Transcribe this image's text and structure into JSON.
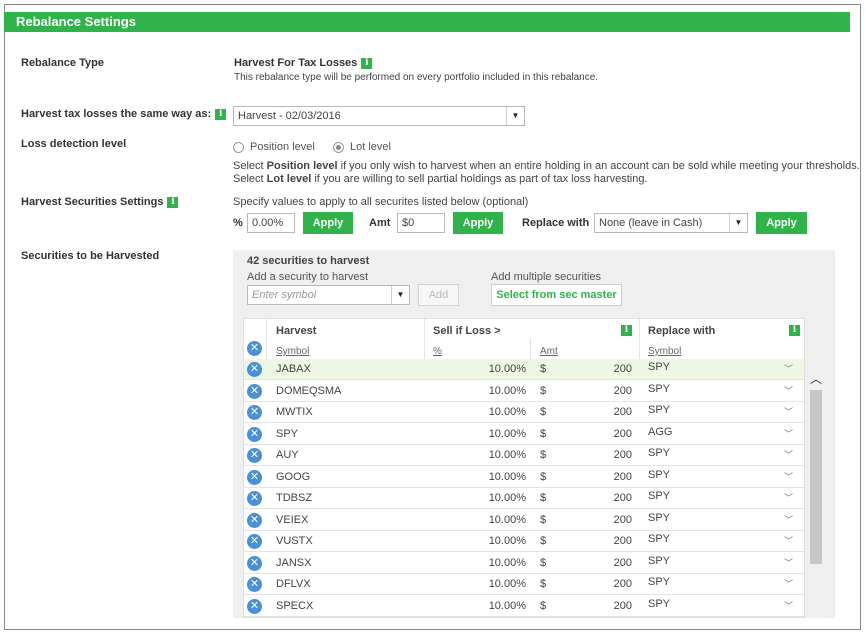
{
  "header": {
    "title": "Rebalance Settings"
  },
  "rebalance_type": {
    "label": "Rebalance Type",
    "value": "Harvest For Tax Losses",
    "description": "This rebalance type will be performed on every portfolio included in this rebalance."
  },
  "harvest_same": {
    "label": "Harvest tax losses the same way as:",
    "selected": "Harvest - 02/03/2016"
  },
  "loss_detection": {
    "label": "Loss detection level",
    "option_position": "Position level",
    "option_lot": "Lot level",
    "selected": "Lot level",
    "help1_pre": "Select ",
    "help1_bold": "Position level",
    "help1_post": " if you only wish to harvest when an entire holding in an account can be sold while meeting your thresholds.",
    "help2_pre": "Select ",
    "help2_bold": "Lot level",
    "help2_post": " if you are willing to sell partial holdings as part of tax loss harvesting."
  },
  "harvest_settings": {
    "label": "Harvest Securities Settings",
    "description": "Specify values to apply to all securites listed below (optional)",
    "pct_label": "%",
    "pct_value": "0.00%",
    "apply_label": "Apply",
    "amt_label": "Amt",
    "amt_value": "$0",
    "replace_label": "Replace with",
    "replace_selected": "None (leave in Cash)"
  },
  "securities": {
    "label": "Securities to be Harvested",
    "count_text": "42 securities to harvest",
    "add_label": "Add a security to harvest",
    "symbol_placeholder": "Enter symbol",
    "add_button": "Add",
    "multi_label": "Add multiple securities",
    "sec_master_button": "Select from sec master",
    "columns": {
      "harvest": "Harvest",
      "symbol": "Symbol",
      "sell_if_loss": "Sell if Loss >",
      "pct": "%",
      "amt": "Amt",
      "replace_with": "Replace with",
      "replace_symbol": "Symbol"
    },
    "rows": [
      {
        "symbol": "JABAX",
        "pct": "10.00%",
        "currency": "$",
        "amt": "200",
        "replace": "SPY"
      },
      {
        "symbol": "DOMEQSMA",
        "pct": "10.00%",
        "currency": "$",
        "amt": "200",
        "replace": "SPY"
      },
      {
        "symbol": "MWTIX",
        "pct": "10.00%",
        "currency": "$",
        "amt": "200",
        "replace": "SPY"
      },
      {
        "symbol": "SPY",
        "pct": "10.00%",
        "currency": "$",
        "amt": "200",
        "replace": "AGG"
      },
      {
        "symbol": "AUY",
        "pct": "10.00%",
        "currency": "$",
        "amt": "200",
        "replace": "SPY"
      },
      {
        "symbol": "GOOG",
        "pct": "10.00%",
        "currency": "$",
        "amt": "200",
        "replace": "SPY"
      },
      {
        "symbol": "TDBSZ",
        "pct": "10.00%",
        "currency": "$",
        "amt": "200",
        "replace": "SPY"
      },
      {
        "symbol": "VEIEX",
        "pct": "10.00%",
        "currency": "$",
        "amt": "200",
        "replace": "SPY"
      },
      {
        "symbol": "VUSTX",
        "pct": "10.00%",
        "currency": "$",
        "amt": "200",
        "replace": "SPY"
      },
      {
        "symbol": "JANSX",
        "pct": "10.00%",
        "currency": "$",
        "amt": "200",
        "replace": "SPY"
      },
      {
        "symbol": "DFLVX",
        "pct": "10.00%",
        "currency": "$",
        "amt": "200",
        "replace": "SPY"
      },
      {
        "symbol": "SPECX",
        "pct": "10.00%",
        "currency": "$",
        "amt": "200",
        "replace": "SPY"
      }
    ]
  },
  "colors": {
    "accent": "#2fb34a",
    "remove_icon": "#4a90d9",
    "row_highlight": "#eef6e4"
  },
  "icons": {
    "info": "info-icon",
    "remove": "remove-icon",
    "dropdown": "caret-down-icon",
    "replace_toggle": "double-chevron-down-icon",
    "scroll_up": "chevron-up-icon"
  }
}
